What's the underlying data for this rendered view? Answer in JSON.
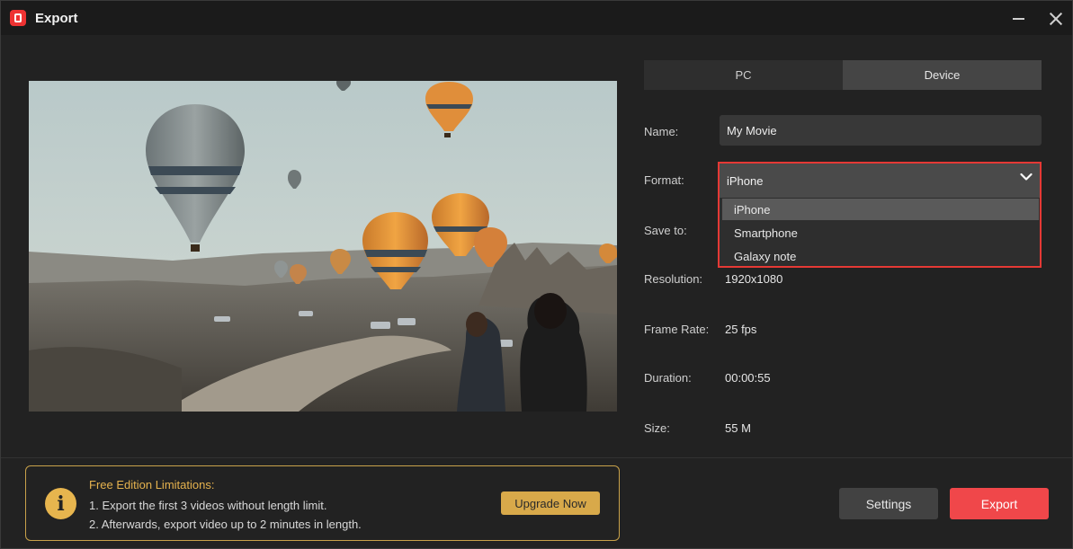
{
  "window": {
    "title": "Export"
  },
  "tabs": {
    "pc": "PC",
    "device": "Device",
    "active": "Device"
  },
  "fields": {
    "name_label": "Name:",
    "name_value": "My Movie",
    "format_label": "Format:",
    "format_value": "iPhone",
    "format_options": [
      "iPhone",
      "Smartphone",
      "Galaxy note"
    ],
    "save_label": "Save to:",
    "resolution_label": "Resolution:",
    "resolution_value": "1920x1080",
    "framerate_label": "Frame Rate:",
    "framerate_value": "25 fps",
    "duration_label": "Duration:",
    "duration_value": "00:00:55",
    "size_label": "Size:",
    "size_value": "55 M"
  },
  "notice": {
    "title": "Free Edition Limitations:",
    "line1": "1. Export the first 3 videos without length limit.",
    "line2": "2. Afterwards, export video up to 2 minutes in length.",
    "upgrade_label": "Upgrade Now"
  },
  "buttons": {
    "settings": "Settings",
    "export": "Export"
  },
  "icons": {
    "app": "app-logo-icon",
    "minimize": "minimize-icon",
    "close": "close-icon",
    "chevron": "chevron-down-icon",
    "info": "info-icon"
  },
  "colors": {
    "accent_red": "#f0474a",
    "highlight_border": "#e53935",
    "notice_gold": "#e5b24e",
    "upgrade_bg": "#d8a94a"
  }
}
